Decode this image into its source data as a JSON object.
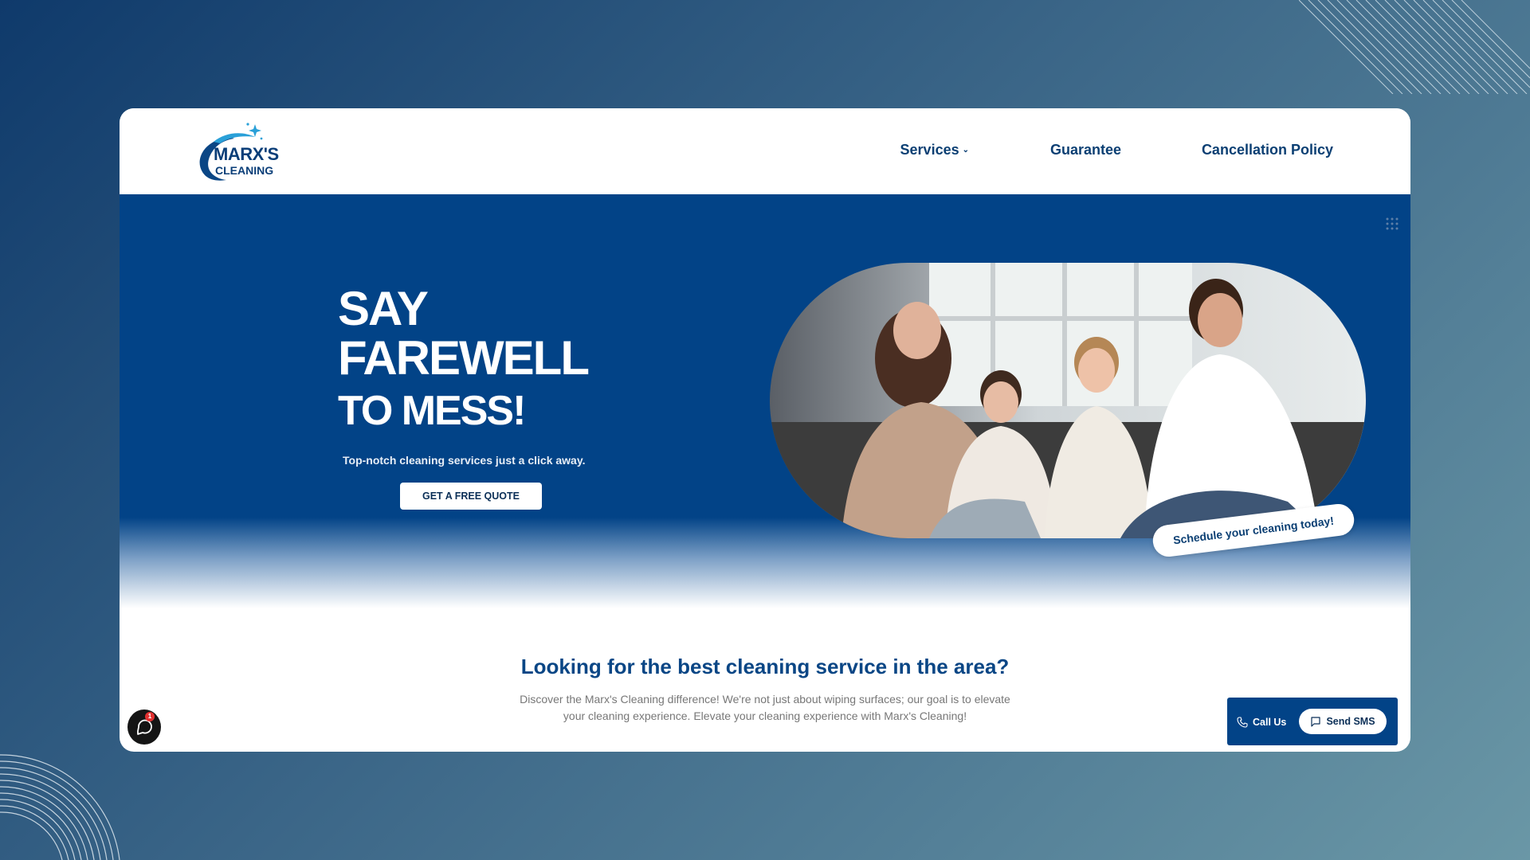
{
  "brand": {
    "line1": "MARX'S",
    "line2": "CLEANING"
  },
  "nav": {
    "services": "Services",
    "guarantee": "Guarantee",
    "cancellation": "Cancellation Policy"
  },
  "hero": {
    "headline_1": "SAY",
    "headline_2": "FAREWELL",
    "headline_3": "TO MESS!",
    "subtext": "Top-notch cleaning services just a click away.",
    "cta": "GET A FREE QUOTE",
    "badge": "Schedule your cleaning today!"
  },
  "section": {
    "title": "Looking for the best cleaning service in the area?",
    "description": "Discover the Marx's Cleaning difference! We're not just about wiping surfaces; our goal is to elevate your cleaning experience. Elevate your cleaning experience with Marx's Cleaning!"
  },
  "chat": {
    "badge_count": "1"
  },
  "contact": {
    "call": "Call Us",
    "sms": "Send SMS"
  },
  "colors": {
    "brand_blue": "#024387",
    "heading_blue": "#0a4685"
  },
  "icons": [
    "chevron-down-icon",
    "grid-dots-icon",
    "chat-icon",
    "phone-icon",
    "message-icon"
  ]
}
